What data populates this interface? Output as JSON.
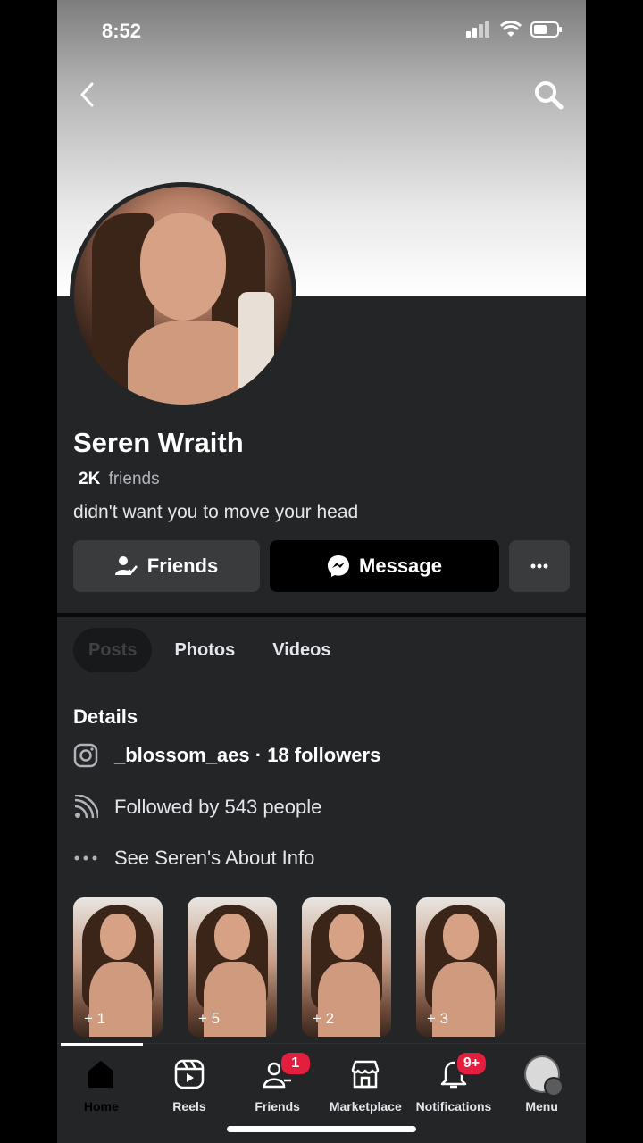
{
  "status_bar": {
    "time": "8:52"
  },
  "cover": {
    "back_icon": "chevron-left-icon",
    "search_icon": "search-icon"
  },
  "profile": {
    "name": "Seren Wraith",
    "friends_count": "2K",
    "friends_label": "friends",
    "bio": "didn't want you to move your head"
  },
  "actions": {
    "friends_label": "Friends",
    "message_label": "Message",
    "more_icon": "ellipsis-icon"
  },
  "tabs": [
    {
      "label": "Posts",
      "active": true
    },
    {
      "label": "Photos",
      "active": false
    },
    {
      "label": "Videos",
      "active": false
    }
  ],
  "details": {
    "title": "Details",
    "instagram": "_blossom_aes · 18 followers",
    "followed_by": "Followed by 543 people",
    "about": "See Seren's About Info"
  },
  "highlights": [
    {
      "count": "+ 1"
    },
    {
      "count": "+ 5"
    },
    {
      "count": "+ 2"
    },
    {
      "count": "+ 3"
    }
  ],
  "nav": [
    {
      "label": "Home",
      "icon": "home-icon",
      "active": true,
      "badge": ""
    },
    {
      "label": "Reels",
      "icon": "reels-icon",
      "active": false,
      "badge": ""
    },
    {
      "label": "Friends",
      "icon": "friends-icon",
      "active": false,
      "badge": "1"
    },
    {
      "label": "Marketplace",
      "icon": "marketplace-icon",
      "active": false,
      "badge": ""
    },
    {
      "label": "Notifications",
      "icon": "bell-icon",
      "active": false,
      "badge": "9+"
    },
    {
      "label": "Menu",
      "icon": "menu-avatar-icon",
      "active": false,
      "badge": ""
    }
  ],
  "colors": {
    "background": "#242526",
    "button_secondary": "#3a3b3c",
    "badge": "#e41e3f"
  }
}
